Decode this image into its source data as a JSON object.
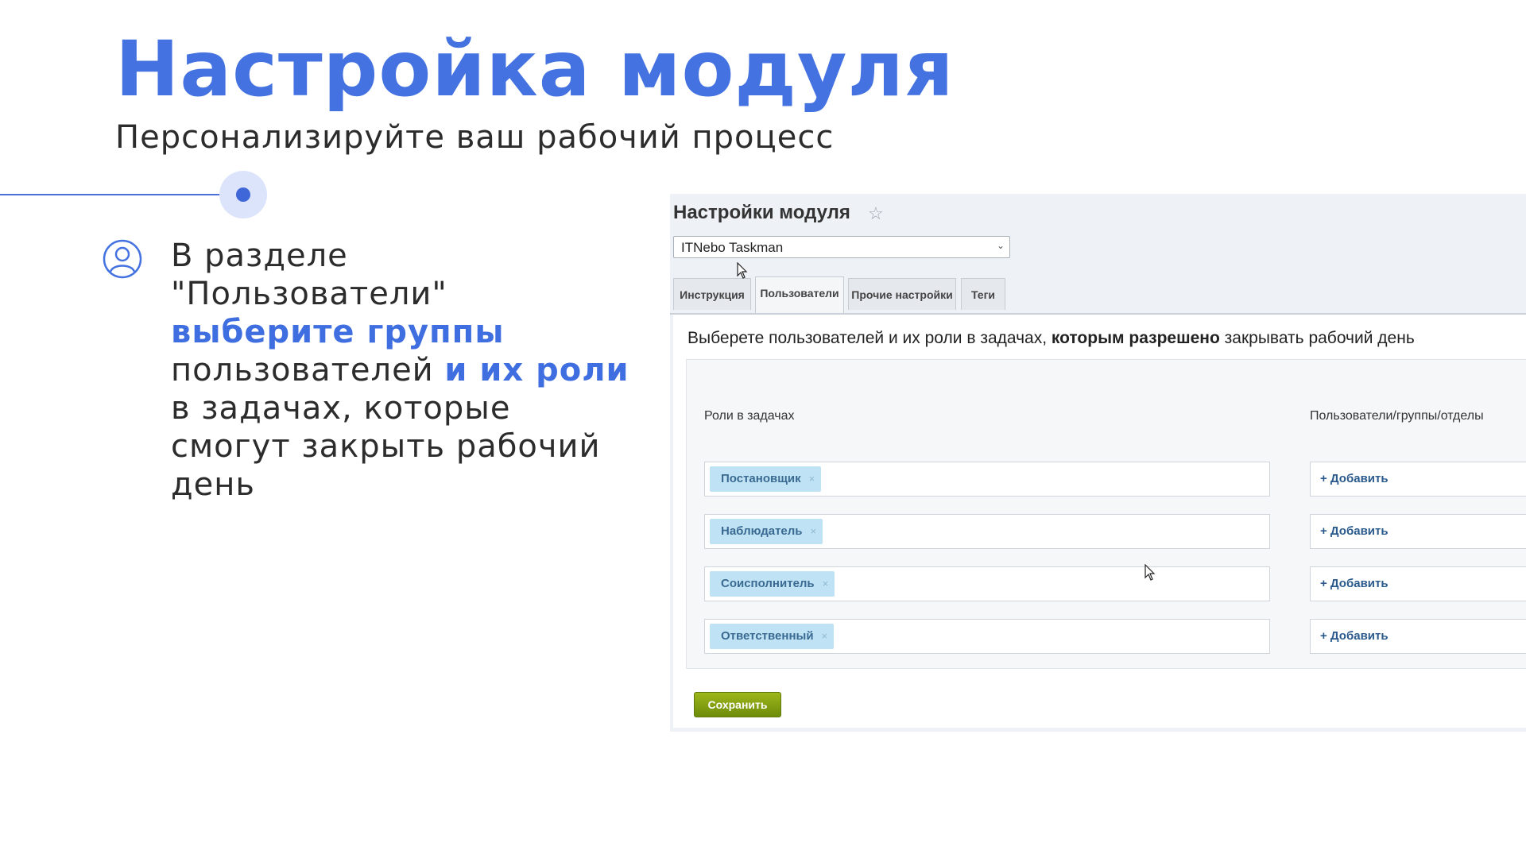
{
  "slide": {
    "title": "Настройка модуля",
    "subtitle": "Персонализируйте ваш рабочий процесс",
    "bullet": {
      "part1": "В разделе \"Пользователи\" ",
      "part2": "выберите группы",
      "part3": " пользователей ",
      "part4": "и их роли",
      "part5": " в задачах, которые смогут закрыть рабочий день"
    }
  },
  "panel": {
    "title": "Настройки модуля",
    "module_select": "ITNebo Taskman",
    "tabs": [
      "Инструкция",
      "Пользователи",
      "Прочие настройки",
      "Теги"
    ],
    "active_tab": "Пользователи",
    "description": {
      "before": "Выберете пользователей и их роли в задачах, ",
      "bold": "которым разрешено",
      "after": " закрывать рабочий день"
    },
    "col_roles": "Роли в задачах",
    "col_users": "Пользователи/группы/отделы",
    "roles": [
      {
        "label": "Постановщик",
        "remove": "×",
        "add": "+ Добавить"
      },
      {
        "label": "Наблюдатель",
        "remove": "×",
        "add": "+ Добавить"
      },
      {
        "label": "Соисполнитель",
        "remove": "×",
        "add": "+ Добавить"
      },
      {
        "label": "Ответственный",
        "remove": "×",
        "add": "+ Добавить"
      }
    ],
    "save_label": "Сохранить"
  },
  "icons": {
    "user": "user-circle-icon",
    "star": "star-icon",
    "dropdown": "chevron-down-icon"
  },
  "colors": {
    "accent": "#4472e0",
    "save": "#7d9a10",
    "tag_bg": "#bfe3f4"
  }
}
